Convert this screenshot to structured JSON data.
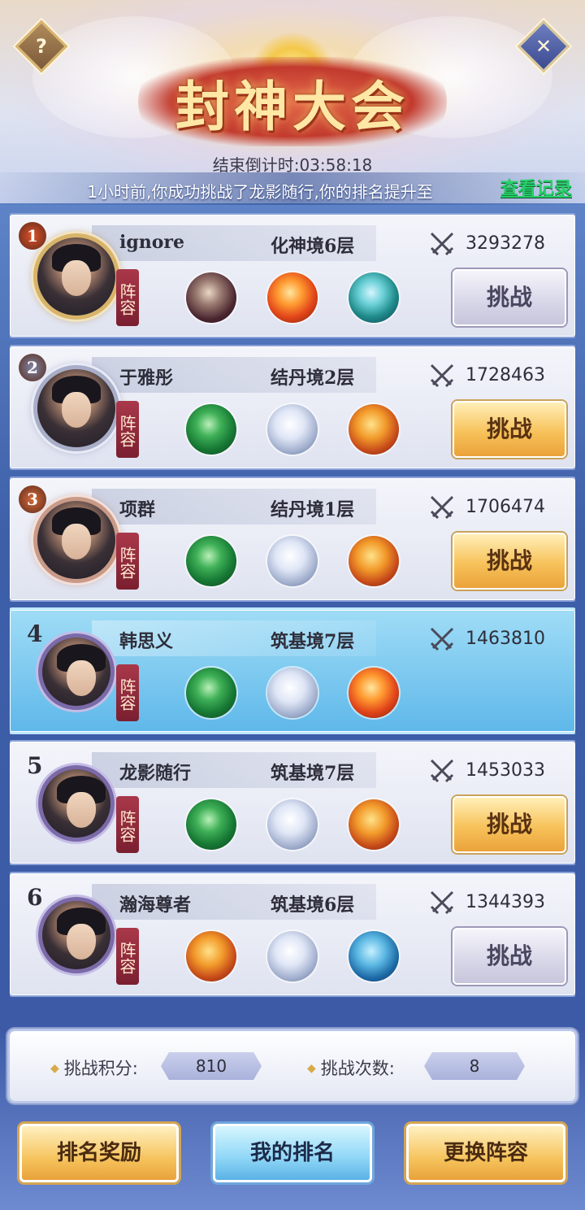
{
  "header": {
    "title": "封神大会",
    "help_icon": "?",
    "close_icon": "✕",
    "countdown_label": "结束倒计时:03:58:18",
    "notice": "1小时前,你成功挑战了龙影随行,你的排名提升至",
    "view_record_label": "查看记录"
  },
  "lineup_label": "阵容",
  "players": [
    {
      "rank": "1",
      "name": "ignore",
      "realm": "化神境6层",
      "power": "3293278",
      "pets": [
        "dragon-dark",
        "phoenix",
        "dragon-jade"
      ],
      "button": "挑战",
      "button_style": "gray",
      "frame": "gold",
      "is_me": false
    },
    {
      "rank": "2",
      "name": "于雅彤",
      "realm": "结丹境2层",
      "power": "1728463",
      "pets": [
        "dragon-green",
        "tiger-white",
        "dragon-gold"
      ],
      "button": "挑战",
      "button_style": "gold",
      "frame": "silver",
      "is_me": false
    },
    {
      "rank": "3",
      "name": "项群",
      "realm": "结丹境1层",
      "power": "1706474",
      "pets": [
        "dragon-green",
        "tiger-white",
        "dragon-gold"
      ],
      "button": "挑战",
      "button_style": "gold",
      "frame": "bronze",
      "is_me": false
    },
    {
      "rank": "4",
      "name": "韩思义",
      "realm": "筑基境7层",
      "power": "1463810",
      "pets": [
        "dragon-green",
        "tiger-white",
        "phoenix"
      ],
      "button": "",
      "button_style": "none",
      "frame": "plain",
      "is_me": true
    },
    {
      "rank": "5",
      "name": "龙影随行",
      "realm": "筑基境7层",
      "power": "1453033",
      "pets": [
        "dragon-green",
        "tiger-white",
        "dragon-gold"
      ],
      "button": "挑战",
      "button_style": "gold",
      "frame": "plain",
      "is_me": false
    },
    {
      "rank": "6",
      "name": "瀚海尊者",
      "realm": "筑基境6层",
      "power": "1344393",
      "pets": [
        "dragon-gold",
        "tiger-white",
        "whale"
      ],
      "button": "挑战",
      "button_style": "gray",
      "frame": "plain",
      "is_me": false
    }
  ],
  "stats": {
    "points_label": "挑战积分:",
    "points_value": "810",
    "attempts_label": "挑战次数:",
    "attempts_value": "8"
  },
  "bottom": {
    "reward_label": "排名奖励",
    "my_rank_label": "我的排名",
    "change_lineup_label": "更换阵容"
  },
  "colors": {
    "accent_gold": "#f7c25a",
    "record_green": "#27d06a",
    "me_highlight": "#5fb8ea"
  }
}
